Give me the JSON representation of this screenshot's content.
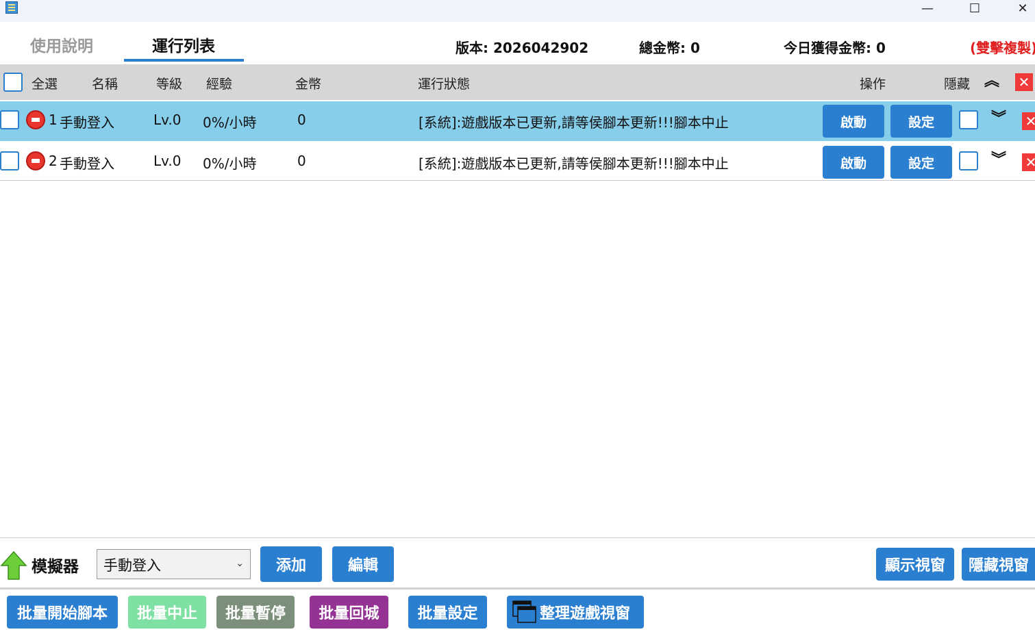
{
  "window": {
    "minimize_icon": "—",
    "maximize_icon": "☐",
    "close_icon": "✕"
  },
  "tabs": {
    "usage": "使用說明",
    "run_list": "運行列表"
  },
  "info": {
    "version": "版本: 2026042902",
    "total_coins": "總金幣: 0",
    "today_coins": "今日獲得金幣: 0",
    "double_click_copy": "(雙擊複製)"
  },
  "table": {
    "headers": {
      "select_all": "全選",
      "name": "名稱",
      "level": "等級",
      "exp": "經驗",
      "coins": "金幣",
      "status": "運行狀態",
      "actions": "操作",
      "hide": "隱藏"
    },
    "rows": [
      {
        "index": "1",
        "name": "手動登入",
        "level": "Lv.0",
        "exp": "0%/小時",
        "coins": "0",
        "status": "[系統]:遊戲版本已更新,請等侯腳本更新!!!腳本中止",
        "start": "啟動",
        "settings": "設定"
      },
      {
        "index": "2",
        "name": "手動登入",
        "level": "Lv.0",
        "exp": "0%/小時",
        "coins": "0",
        "status": "[系統]:遊戲版本已更新,請等侯腳本更新!!!腳本中止",
        "start": "啟動",
        "settings": "設定"
      }
    ]
  },
  "toolbar": {
    "emulator_label": "模擬器",
    "emulator_selected": "手動登入",
    "add": "添加",
    "edit": "編輯",
    "show_window": "顯示視窗",
    "hide_window": "隱藏視窗"
  },
  "batch": {
    "start": "批量開始腳本",
    "stop": "批量中止",
    "pause": "批量暫停",
    "return_town": "批量回城",
    "settings": "批量設定",
    "arrange": "整理遊戲視窗"
  },
  "colors": {
    "primary": "#2b7fd1",
    "selected_row": "#87ceeb",
    "header_bg": "#d6d6d6",
    "danger": "#f03a3a",
    "batch_stop": "#7fe0a3",
    "batch_pause": "#7b8f7b",
    "batch_return": "#943394"
  }
}
